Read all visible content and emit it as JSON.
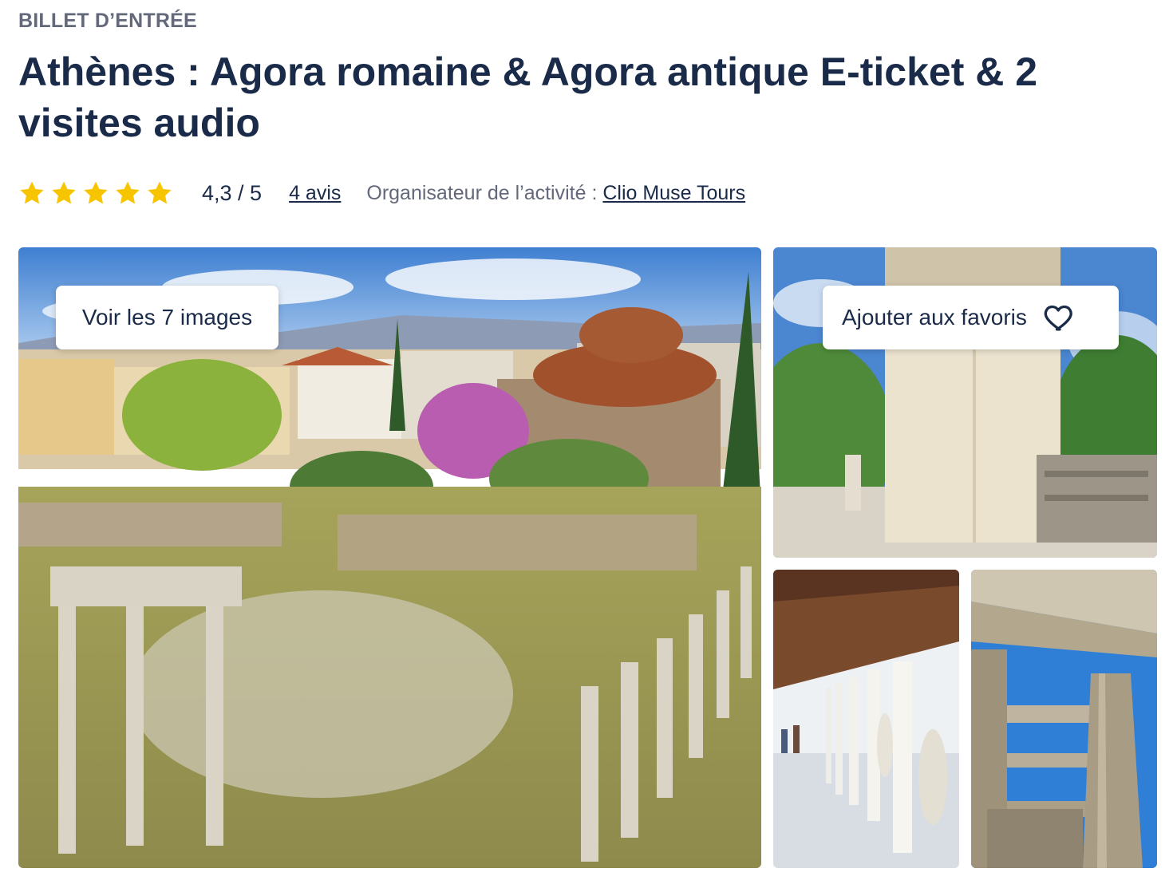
{
  "header": {
    "eyebrow": "BILLET D’ENTRÉE",
    "title": "Athènes : Agora romaine & Agora antique E-ticket & 2 visites audio"
  },
  "rating": {
    "stars_value": 5,
    "stars_max": 5,
    "star_color": "#f7c400",
    "score_text": "4,3 / 5",
    "reviews_link": "4 avis",
    "organizer_label": "Organisateur de l’activité : ",
    "organizer_name": "Clio Muse Tours"
  },
  "gallery": {
    "view_images_button": "Voir les 7 images",
    "favorite_button": "Ajouter aux favoris",
    "favorite_icon": "heart-outline-icon",
    "photos": [
      "roman-agora-photo",
      "tower-of-winds-photo",
      "stoa-colonnade-photo",
      "temple-columns-photo"
    ]
  },
  "colors": {
    "text_primary": "#1a2b49",
    "text_secondary": "#63687a"
  }
}
